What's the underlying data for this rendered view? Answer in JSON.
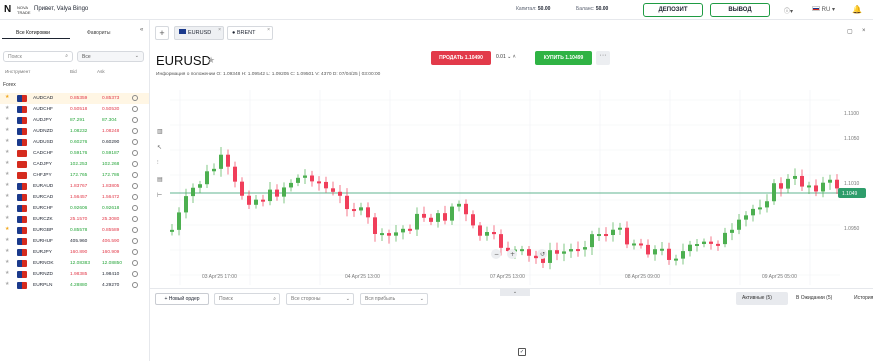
{
  "header": {
    "logo_mark": "N",
    "logo_text1": "NOVA",
    "logo_text2": "TRADE",
    "greeting": "Привет, Valya Bingo",
    "capital_label": "Капитал:",
    "capital_value": "50.00",
    "balance_label": "Баланс:",
    "balance_value": "50.00",
    "deposit": "ДЕПОЗИТ",
    "withdraw": "ВЫВОД",
    "lang": "RU"
  },
  "sidebar": {
    "tab_all": "Все Котировки",
    "tab_fav": "Фавориты",
    "search_placeholder": "Поиск",
    "filter": "Все",
    "col_instrument": "Инструмент",
    "col_bid": "Bid",
    "col_ask": "Ask",
    "group": "Forex",
    "rows": [
      {
        "name": "AUDCAD",
        "bid": "0.85359",
        "ask": "0.85373",
        "bc": "red",
        "ac": "red",
        "fav": true,
        "flag": "#1b3a8c"
      },
      {
        "name": "AUDCHF",
        "bid": "0.50518",
        "ask": "0.50530",
        "bc": "red",
        "ac": "red",
        "fav": false,
        "flag": "#1b3a8c"
      },
      {
        "name": "AUDJPY",
        "bid": "87.291",
        "ask": "87.304",
        "bc": "grn",
        "ac": "grn",
        "fav": false,
        "flag": "#1b3a8c"
      },
      {
        "name": "AUDNZD",
        "bid": "1.08232",
        "ask": "1.08248",
        "bc": "grn",
        "ac": "red",
        "fav": false,
        "flag": "#1b3a8c"
      },
      {
        "name": "AUDUSD",
        "bid": "0.60276",
        "ask": "0.60290",
        "bc": "grn",
        "ac": "blk",
        "fav": false,
        "flag": "#1b3a8c"
      },
      {
        "name": "CADCHF",
        "bid": "0.59176",
        "ask": "0.59187",
        "bc": "grn",
        "ac": "grn",
        "fav": false,
        "flag": "#d52b1e"
      },
      {
        "name": "CADJPY",
        "bid": "102.253",
        "ask": "102.268",
        "bc": "grn",
        "ac": "grn",
        "fav": false,
        "flag": "#d52b1e"
      },
      {
        "name": "CHFJPY",
        "bid": "172.765",
        "ask": "172.786",
        "bc": "grn",
        "ac": "grn",
        "fav": false,
        "flag": "#d52b1e"
      },
      {
        "name": "EURAUD",
        "bid": "1.83767",
        "ask": "1.83805",
        "bc": "red",
        "ac": "red",
        "fav": false,
        "flag": "#1b3a8c"
      },
      {
        "name": "EURCAD",
        "bid": "1.56457",
        "ask": "1.56472",
        "bc": "red",
        "ac": "red",
        "fav": false,
        "flag": "#1b3a8c"
      },
      {
        "name": "EURCHF",
        "bid": "0.92606",
        "ask": "0.92618",
        "bc": "grn",
        "ac": "grn",
        "fav": false,
        "flag": "#1b3a8c"
      },
      {
        "name": "EURCZK",
        "bid": "25.1570",
        "ask": "25.3080",
        "bc": "red",
        "ac": "red",
        "fav": false,
        "flag": "#1b3a8c"
      },
      {
        "name": "EURGBP",
        "bid": "0.85578",
        "ask": "0.85589",
        "bc": "grn",
        "ac": "red",
        "fav": true,
        "flag": "#1b3a8c"
      },
      {
        "name": "EURHUF",
        "bid": "405.960",
        "ask": "406.590",
        "bc": "blk",
        "ac": "red",
        "fav": false,
        "flag": "#1b3a8c"
      },
      {
        "name": "EURJPY",
        "bid": "160.890",
        "ask": "160.909",
        "bc": "red",
        "ac": "red",
        "fav": false,
        "flag": "#1b3a8c"
      },
      {
        "name": "EURNOK",
        "bid": "12.08383",
        "ask": "12.08850",
        "bc": "grn",
        "ac": "grn",
        "fav": false,
        "flag": "#1b3a8c"
      },
      {
        "name": "EURNZD",
        "bid": "1.98385",
        "ask": "1.98410",
        "bc": "red",
        "ac": "blk",
        "fav": false,
        "flag": "#1b3a8c"
      },
      {
        "name": "EURPLN",
        "bid": "4.28880",
        "ask": "4.29270",
        "bc": "grn",
        "ac": "blk",
        "fav": false,
        "flag": "#1b3a8c"
      }
    ]
  },
  "main": {
    "tab1": "EURUSD",
    "tab2": "BRENT",
    "symbol": "EURUSD",
    "info": "Информация о положении    O: 1.09348   H: 1.09542   L: 1.09205   C: 1.09501   V: 4370   D: 07/04/25 | 03:00:00",
    "sell": "ПРОДАТЬ 1.10490",
    "buy": "КУПИТЬ 1.10499",
    "lot": "0.01",
    "price_label": "1.1049",
    "y_ticks": [
      "1.1100",
      "1.1050",
      "1.1010",
      "1.0950"
    ],
    "x_ticks": [
      "03 Apr'25 17:00",
      "04 Apr'25 13:00",
      "07 Apr'25 13:00",
      "08 Apr'25 09:00",
      "09 Apr'25 05:00"
    ]
  },
  "bottom": {
    "new_order": "Новый ордер",
    "search": "Поиск",
    "sides": "Все стороны",
    "profit": "Вся прибыль",
    "active": "Активные (5)",
    "pending": "В Ожидании (5)",
    "history": "История"
  }
}
